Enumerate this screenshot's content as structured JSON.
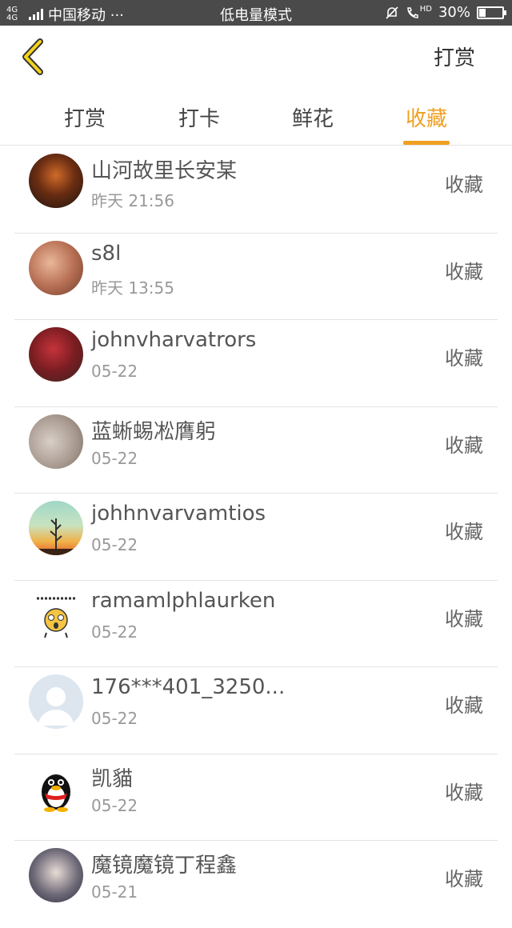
{
  "status_bar": {
    "network": "4G 4G",
    "carrier": "中国移动 ···",
    "mode": "低电量模式",
    "hd": "HD",
    "battery_percent": "30%",
    "battery_level": 0.3
  },
  "header": {
    "action_label": "打赏"
  },
  "tabs": [
    {
      "label": "打赏",
      "active": false
    },
    {
      "label": "打卡",
      "active": false
    },
    {
      "label": "鲜花",
      "active": false
    },
    {
      "label": "收藏",
      "active": true
    }
  ],
  "accent_color": "#f0a020",
  "list": [
    {
      "name": "山河故里长安某",
      "time": "昨天 21:56",
      "action": "收藏"
    },
    {
      "name": "s8l",
      "time": "昨天 13:55",
      "action": "收藏"
    },
    {
      "name": "johnvharvatrors",
      "time": "05-22",
      "action": "收藏"
    },
    {
      "name": "蓝蜥蜴凇膺躬",
      "time": "05-22",
      "action": "收藏"
    },
    {
      "name": "johhnvarvamtios",
      "time": "05-22",
      "action": "收藏"
    },
    {
      "name": "ramamlphlaurken",
      "time": "05-22",
      "action": "收藏"
    },
    {
      "name": "176***401_3250...",
      "time": "05-22",
      "action": "收藏"
    },
    {
      "name": "凯貓",
      "time": "05-22",
      "action": "收藏"
    },
    {
      "name": "魔镜魔镜丁程鑫",
      "time": "05-21",
      "action": "收藏"
    }
  ]
}
